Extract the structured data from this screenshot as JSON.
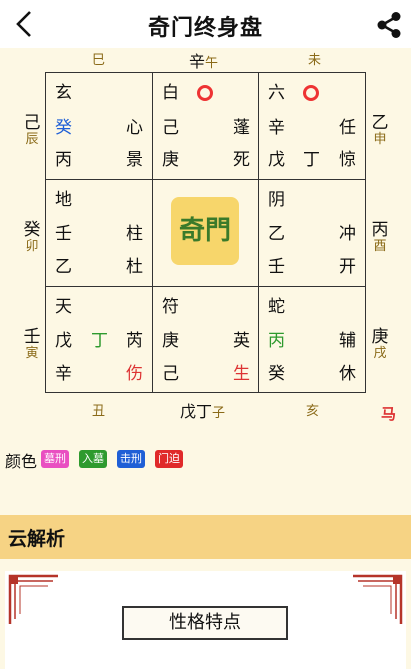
{
  "header": {
    "title": "奇门终身盘"
  },
  "top_labels": {
    "left": "巳",
    "mid_a": "辛",
    "mid_b": "午",
    "right": "未"
  },
  "bottom_labels": {
    "left": "丑",
    "mid_a": "戊丁",
    "mid_b": "子",
    "right": "亥",
    "horse": "马"
  },
  "side_labels": {
    "l1_a": "己",
    "l1_b": "辰",
    "l2_a": "癸",
    "l2_b": "卯",
    "l3_a": "壬",
    "l3_b": "寅",
    "r1_a": "乙",
    "r1_b": "申",
    "r2_a": "丙",
    "r2_b": "酉",
    "r3_a": "庚",
    "r3_b": "戌"
  },
  "palaces": {
    "p1": {
      "god": "玄",
      "r2l": "癸",
      "r2r": "心",
      "r3l": "丙",
      "r3r": "景"
    },
    "p2": {
      "god": "白",
      "r2l": "己",
      "r2r": "蓬",
      "r3l": "庚",
      "r3r": "死"
    },
    "p3": {
      "god": "六",
      "r2l": "辛",
      "r2r": "任",
      "r3l": "戊",
      "r3m": "丁",
      "r3r": "惊"
    },
    "p4": {
      "god": "地",
      "r2l": "壬",
      "r2r": "柱",
      "r3l": "乙",
      "r3r": "杜"
    },
    "p5": {
      "logo": "奇門"
    },
    "p6": {
      "god": "阴",
      "r2l": "乙",
      "r2r": "冲",
      "r3l": "壬",
      "r3r": "开"
    },
    "p7": {
      "god": "天",
      "r2l": "戊",
      "r2m": "丁",
      "r2r": "芮",
      "r3l": "辛",
      "r3r": "伤"
    },
    "p8": {
      "god": "符",
      "r2l": "庚",
      "r2r": "英",
      "r3l": "己",
      "r3r": "生"
    },
    "p9": {
      "god": "蛇",
      "r2l": "丙",
      "r2r": "辅",
      "r3l": "癸",
      "r3r": "休"
    }
  },
  "legend": {
    "label": "颜色",
    "items": [
      {
        "text": "墓刑",
        "color": "#e94fc1"
      },
      {
        "text": "入墓",
        "color": "#2e9a2e"
      },
      {
        "text": "击刑",
        "color": "#1f5fd6"
      },
      {
        "text": "门迫",
        "color": "#e02a2a"
      }
    ]
  },
  "section": {
    "title": "云解析",
    "card_title": "性格特点"
  }
}
